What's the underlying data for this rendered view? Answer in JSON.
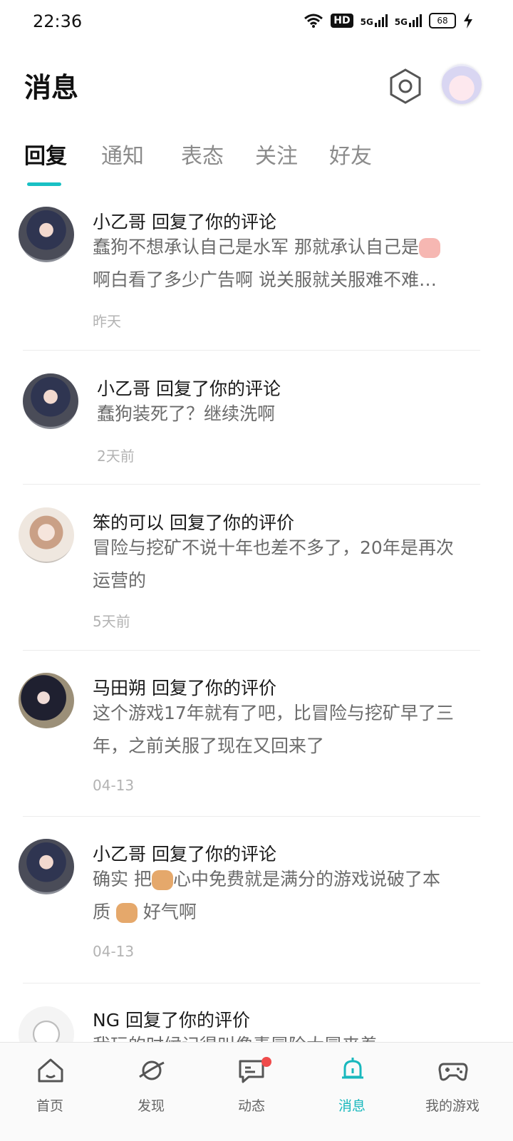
{
  "status_bar": {
    "time": "22:36",
    "hd": "HD",
    "net1": "5G",
    "net2": "5G",
    "battery": "68"
  },
  "header": {
    "title": "消息"
  },
  "tabs": [
    {
      "label": "回复",
      "active": true
    },
    {
      "label": "通知",
      "active": false
    },
    {
      "label": "表态",
      "active": false
    },
    {
      "label": "关注",
      "active": false
    },
    {
      "label": "好友",
      "active": false
    }
  ],
  "messages": [
    {
      "name": "小乙哥 回复了你的评论",
      "text1": "蠢狗不想承认自己是水军 那就承认自己是",
      "text2": "啊白看了多少广告啊 说关服就关服难不难…",
      "time": "昨天",
      "emoji": "pig-emoji"
    },
    {
      "name": "小乙哥 回复了你的评论",
      "text1": "蠢狗装死了？继续洗啊",
      "time": "2天前"
    },
    {
      "name": "笨的可以 回复了你的评价",
      "text1": "冒险与挖矿不说十年也差不多了，20年是再次",
      "text2": "运营的",
      "time": "5天前"
    },
    {
      "name": "马田朔 回复了你的评价",
      "text1": "这个游戏17年就有了吧，比冒险与挖矿早了三",
      "text2": "年，之前关服了现在又回来了",
      "time": "04-13"
    },
    {
      "name": "小乙哥 回复了你的评论",
      "text1a": "确实 把",
      "text1b": "心中免费就是满分的游戏说破了本",
      "text2a": "质",
      "text2b": "好气啊",
      "time": "04-13",
      "emoji": "dog-emoji"
    },
    {
      "name": "NG 回复了你的评价",
      "text1": "我玩的时候记得叫像素冒险大冒来着"
    }
  ],
  "bottom_nav": [
    {
      "label": "首页",
      "icon": "home-icon"
    },
    {
      "label": "发现",
      "icon": "planet-icon"
    },
    {
      "label": "动态",
      "icon": "chat-icon"
    },
    {
      "label": "消息",
      "icon": "bell-icon"
    },
    {
      "label": "我的游戏",
      "icon": "gamepad-icon"
    }
  ],
  "colors": {
    "accent": "#19c0c4",
    "badge": "#ef4b4b"
  }
}
